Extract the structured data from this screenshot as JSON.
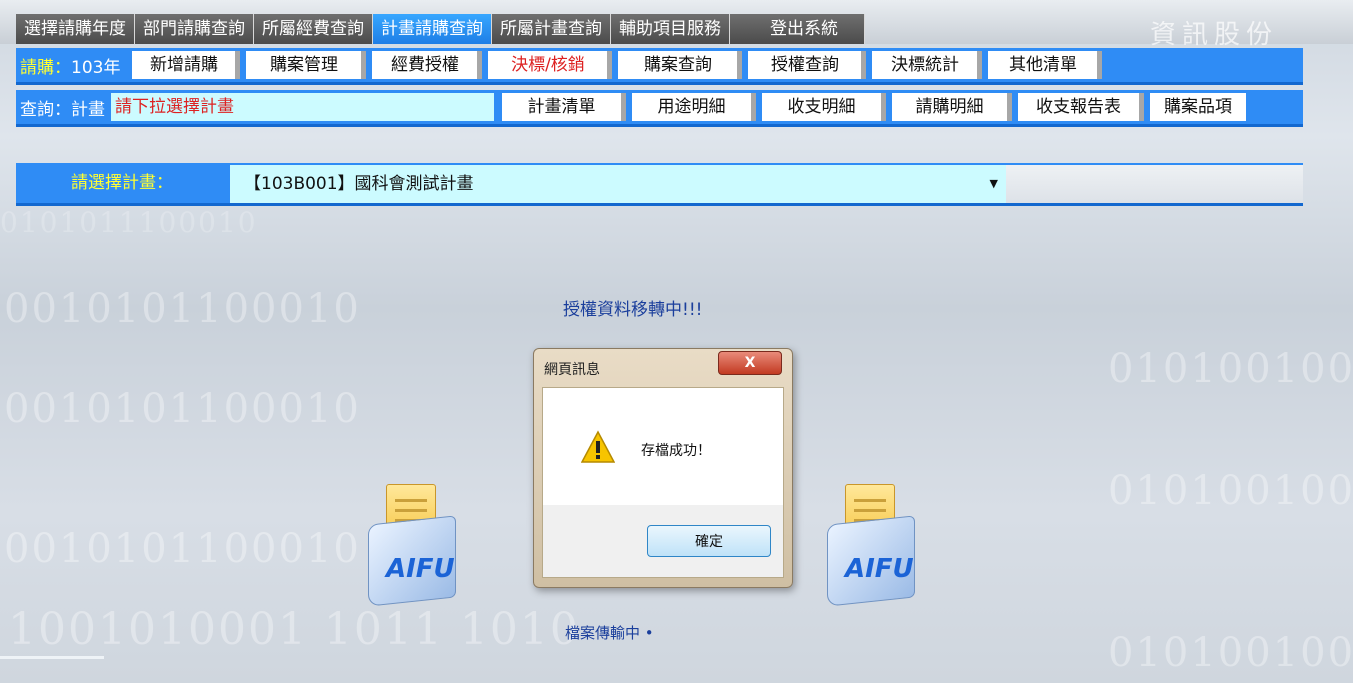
{
  "brand": "資訊股份",
  "background_digits": [
    "0101011100010",
    "0010101100010",
    "0101001001",
    "0010101100010",
    "0101001001",
    "0010101100010",
    "1001010001 1011 1010",
    "0101001001"
  ],
  "main_tabs": [
    "選擇請購年度",
    "部門請購查詢",
    "所屬經費查詢",
    "計畫請購查詢",
    "所屬計畫查詢",
    "輔助項目服務",
    "登出系統"
  ],
  "purchase_row": {
    "label": "請購：",
    "year": "103年",
    "buttons": [
      "新增請購",
      "購案管理",
      "經費授權",
      "決標/核銷",
      "購案查詢",
      "授權查詢",
      "決標統計",
      "其他清單"
    ]
  },
  "query_row": {
    "label": "查詢：計畫",
    "plan_placeholder": "請下拉選擇計畫",
    "buttons": [
      "計畫清單",
      "用途明細",
      "收支明細",
      "請購明細",
      "收支報告表",
      "購案品項"
    ]
  },
  "plan_select": {
    "label": "請選擇計畫：",
    "value": "【103B001】國科會測試計畫"
  },
  "status_message": "授權資料移轉中!!!",
  "folder_logo": "AIFU",
  "transfer_text": "檔案傳輸中 •",
  "dialog": {
    "title": "網頁訊息",
    "close": "X",
    "message": "存檔成功！",
    "ok": "確定"
  },
  "colors": {
    "nav_blue": "#2f8cf5",
    "active_tab": "#1e7ee6",
    "input_bg": "#ccfbff",
    "highlight_red": "#d22222",
    "label_yellow": "#ffff33"
  }
}
